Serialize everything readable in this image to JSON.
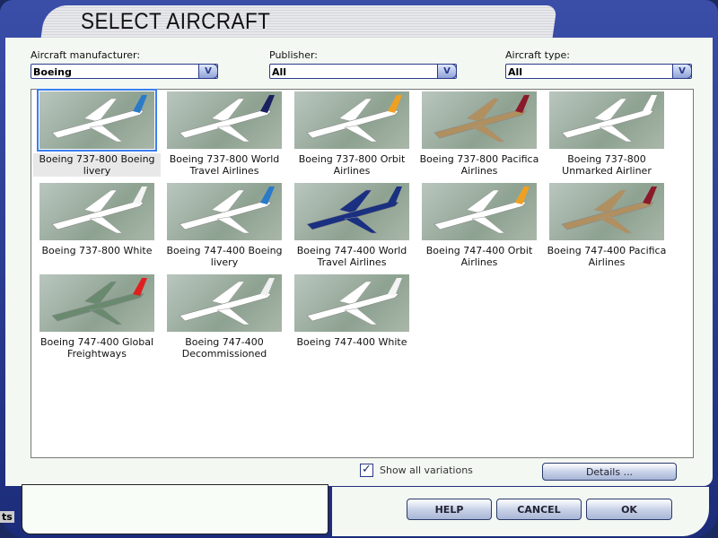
{
  "title": "SELECT AIRCRAFT",
  "filters": {
    "manufacturer": {
      "label": "Aircraft manufacturer:",
      "value": "Boeing"
    },
    "publisher": {
      "label": "Publisher:",
      "value": "All"
    },
    "type": {
      "label": "Aircraft type:",
      "value": "All"
    }
  },
  "aircraft": [
    {
      "name": "Boeing 737-800 Boeing livery",
      "body": "#ffffff",
      "tail": "#2a7ac8",
      "selected": true
    },
    {
      "name": "Boeing 737-800 World Travel Airlines",
      "body": "#ffffff",
      "tail": "#1a2060"
    },
    {
      "name": "Boeing 737-800 Orbit Airlines",
      "body": "#ffffff",
      "tail": "#f0a020"
    },
    {
      "name": "Boeing 737-800 Pacifica Airlines",
      "body": "#b09060",
      "tail": "#8a1a2a"
    },
    {
      "name": "Boeing 737-800 Unmarked Airliner",
      "body": "#ffffff",
      "tail": "#ffffff"
    },
    {
      "name": "Boeing 737-800 White",
      "body": "#ffffff",
      "tail": "#f4f4f4"
    },
    {
      "name": "Boeing 747-400 Boeing livery",
      "body": "#ffffff",
      "tail": "#2a7ac8"
    },
    {
      "name": "Boeing 747-400 World Travel Airlines",
      "body": "#1a3080",
      "tail": "#1a3080"
    },
    {
      "name": "Boeing 747-400 Orbit Airlines",
      "body": "#ffffff",
      "tail": "#f0a020"
    },
    {
      "name": "Boeing 747-400 Pacifica Airlines",
      "body": "#b09060",
      "tail": "#8a1a2a"
    },
    {
      "name": "Boeing 747-400 Global Freightways",
      "body": "#6a8a70",
      "tail": "#e02020"
    },
    {
      "name": "Boeing 747-400 Decommissioned",
      "body": "#ffffff",
      "tail": "#f0f0f0"
    },
    {
      "name": "Boeing 747-400 White",
      "body": "#ffffff",
      "tail": "#f4f4f4"
    }
  ],
  "show_all_variations": {
    "label": "Show all variations",
    "checked": true
  },
  "buttons": {
    "details": "Details ...",
    "help": "HELP",
    "cancel": "CANCEL",
    "ok": "OK"
  },
  "taskbar_fragment": "ts"
}
